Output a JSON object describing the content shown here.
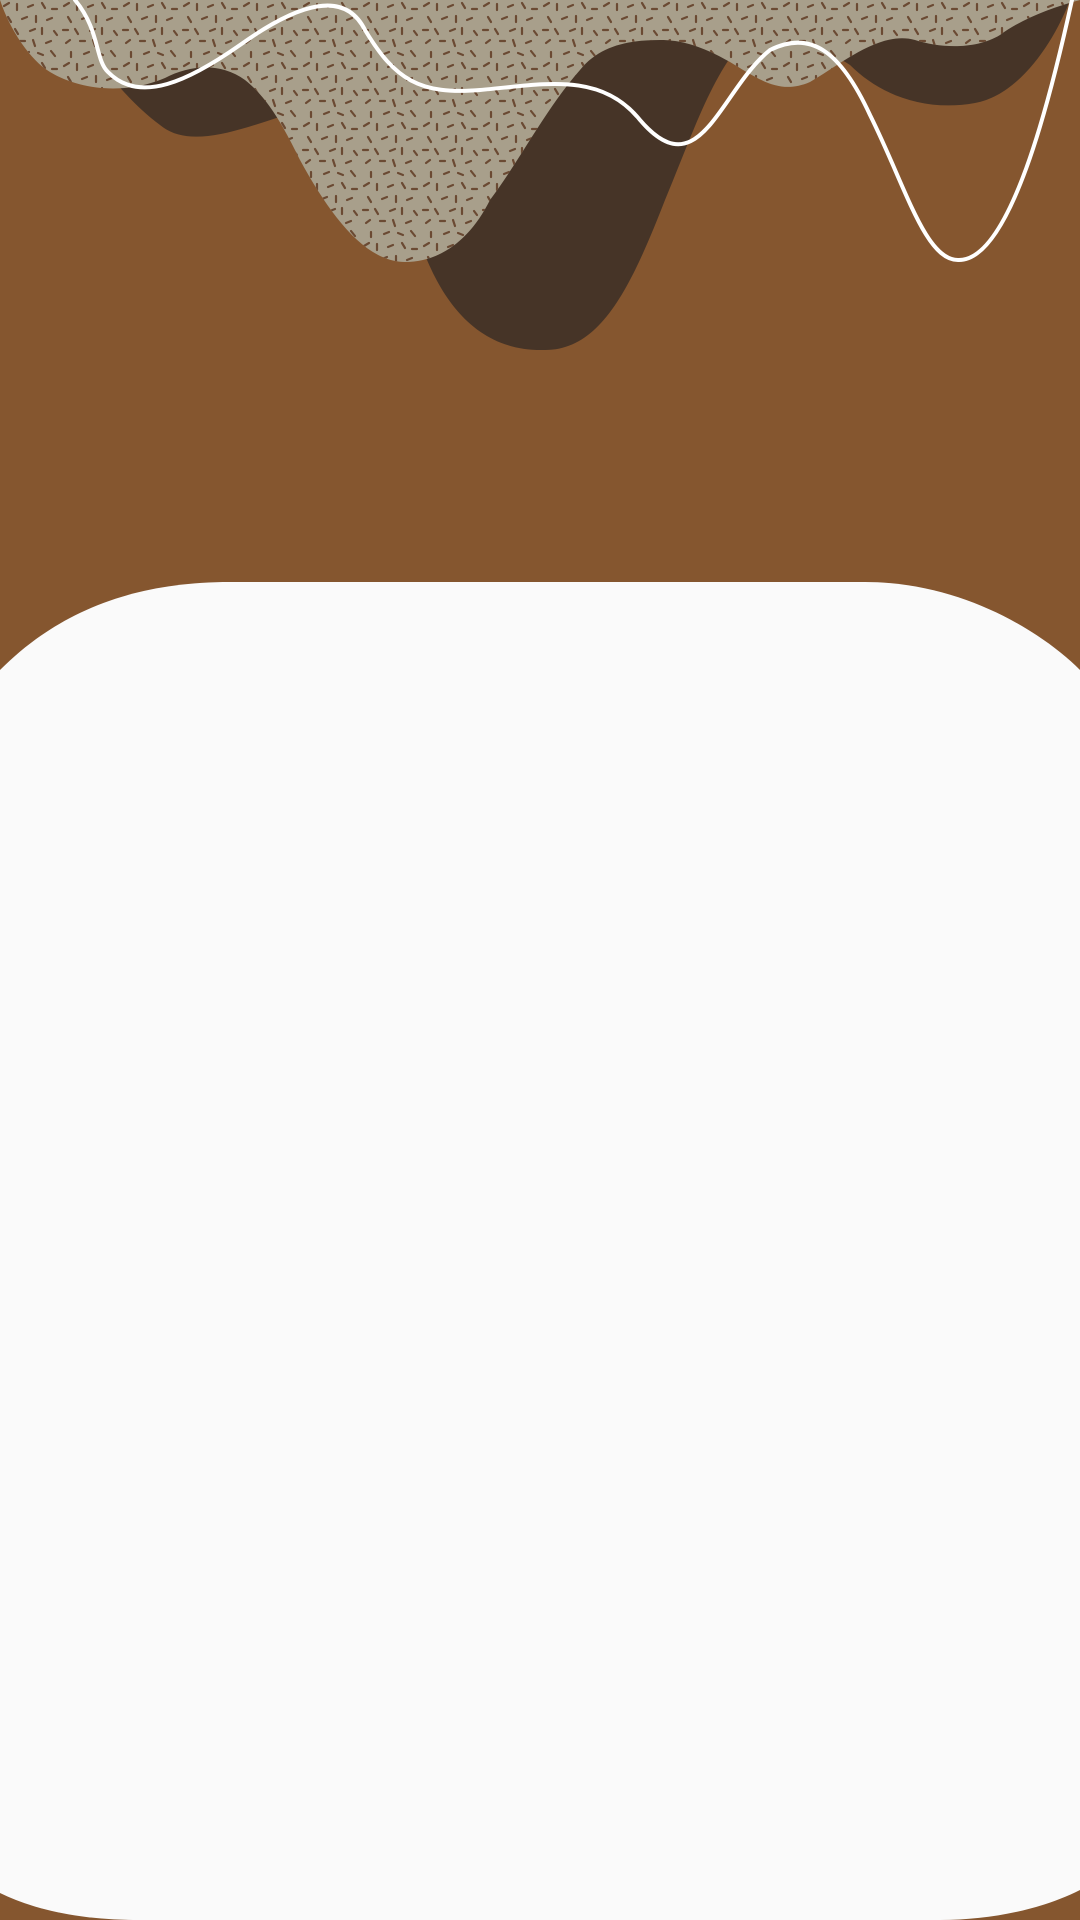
{
  "theme": {
    "background_color": "#85562F",
    "drip_dark_color": "#463427",
    "frosting_color": "#A89F8B",
    "sprinkle_color": "#6B4A33",
    "outline_color": "#FFFFFF",
    "card_color": "#FAFAFA"
  },
  "decorations": {
    "top_art": "chocolate-drip-with-frosting-and-sprinkles",
    "outline": "white-wavy-line"
  },
  "content_card": {
    "state": "empty"
  }
}
